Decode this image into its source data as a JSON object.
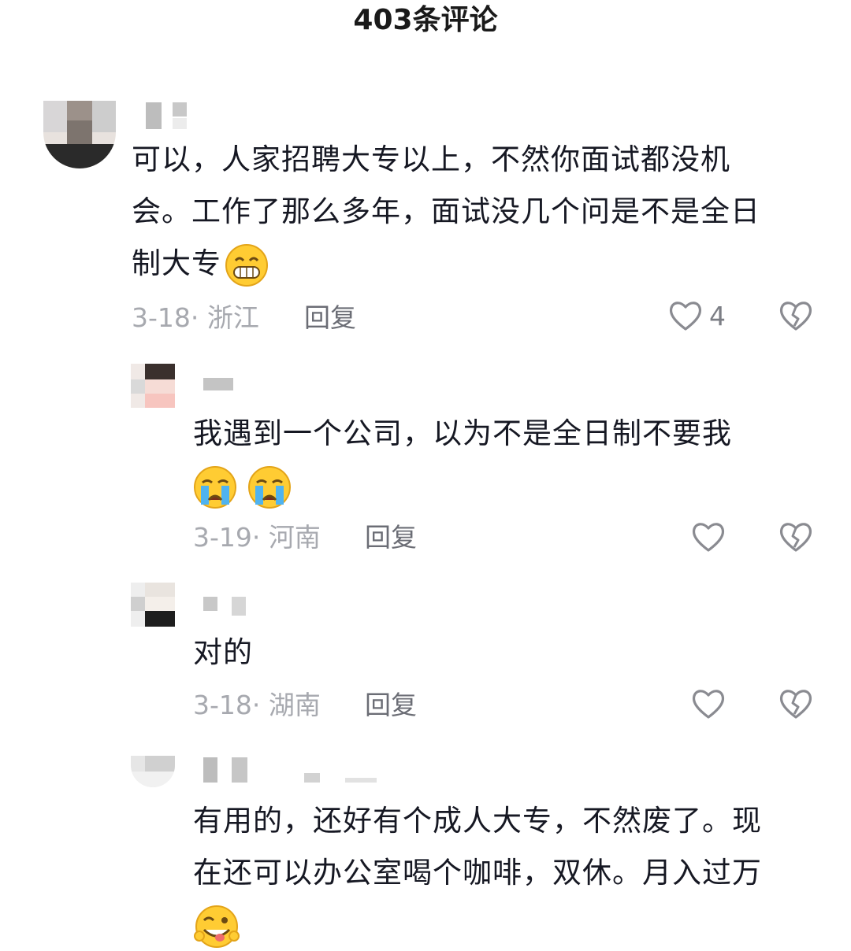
{
  "header": {
    "title": "403条评论"
  },
  "comments": [
    {
      "text_lines": [
        "可以，人家招聘大专以上，不然你面试都没机",
        "会。工作了那么多年，面试没几个问是不是全日",
        "制大专"
      ],
      "emoji": "grinning-squint-emoji",
      "date": "3-18",
      "location": "· 浙江",
      "reply_label": "回复",
      "likes": "4"
    },
    {
      "text_lines": [
        "我遇到一个公司，以为不是全日制不要我"
      ],
      "emoji": "crying-emoji",
      "date": "3-19",
      "location": "· 河南",
      "reply_label": "回复",
      "likes": ""
    },
    {
      "text_lines": [
        "对的"
      ],
      "emoji": "",
      "date": "3-18",
      "location": "· 湖南",
      "reply_label": "回复",
      "likes": ""
    },
    {
      "text_lines": [
        "有用的，还好有个成人大专，不然废了。现",
        "在还可以办公室喝个咖啡，双休。月入过万"
      ],
      "emoji": "winking-tongue-emoji",
      "date": "",
      "location": "",
      "reply_label": "",
      "likes": ""
    }
  ],
  "colors": {
    "text": "#161823",
    "meta": "#a7a9af",
    "reply": "#6b6d75",
    "icon": "#8a8b91"
  }
}
